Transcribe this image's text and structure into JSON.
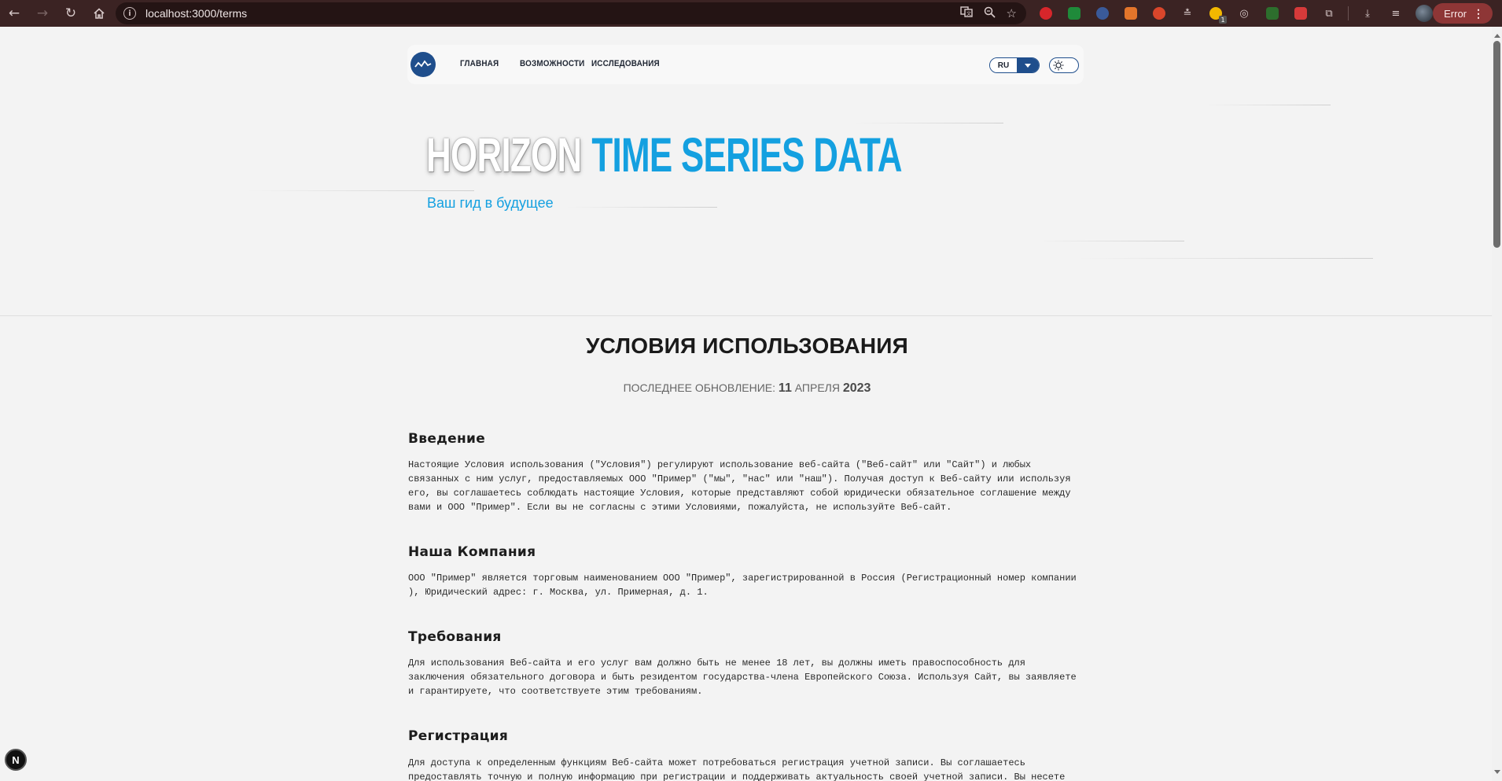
{
  "browser": {
    "url": "localhost:3000/terms",
    "error_label": "Error",
    "extension_badge": "1"
  },
  "navbar": {
    "links": [
      "ГЛАВНАЯ",
      "ВОЗМОЖНОСТИ",
      "ИССЛЕДОВАНИЯ"
    ],
    "language": "RU"
  },
  "hero": {
    "title_part1": "HORIZON",
    "title_part2": "TIME SERIES DATA",
    "subtitle": "Ваш гид в будущее"
  },
  "terms": {
    "title": "УСЛОВИЯ ИСПОЛЬЗОВАНИЯ",
    "updated_prefix": "ПОСЛЕДНЕЕ ОБНОВЛЕНИЕ: ",
    "updated_day": "11",
    "updated_month": " АПРЕЛЯ ",
    "updated_year": "2023",
    "sections": [
      {
        "heading": "Введение",
        "lines": [
          "Настоящие Условия использования (\"Условия\") регулируют использование веб-сайта (\"Веб-сайт\" или \"Сайт\") и любых",
          "связанных с ним услуг, предоставляемых ООО \"Пример\" (\"мы\", \"нас\" или \"наш\"). Получая доступ к Веб-сайту или используя",
          "его, вы соглашаетесь соблюдать настоящие Условия, которые представляют собой юридически обязательное соглашение между",
          "вами и ООО \"Пример\". Если вы не согласны с этими Условиями, пожалуйста, не используйте Веб-сайт."
        ]
      },
      {
        "heading": "Наша Компания",
        "lines": [
          "ООО \"Пример\" является торговым наименованием ООО \"Пример\", зарегистрированной в Россия (Регистрационный номер компании",
          "), Юридический адрес: г. Москва, ул. Примерная, д. 1."
        ]
      },
      {
        "heading": "Требования",
        "lines": [
          "Для использования Веб-сайта и его услуг вам должно быть не менее 18 лет, вы должны иметь правоспособность для",
          "заключения обязательного договора и быть резидентом государства-члена Европейского Союза. Используя Сайт, вы заявляете",
          "и гарантируете, что соответствуете этим требованиям."
        ]
      },
      {
        "heading": "Регистрация",
        "lines": [
          "Для доступа к определенным функциям Веб-сайта может потребоваться регистрация учетной записи. Вы соглашаетесь",
          "предоставлять точную и полную информацию при регистрации и поддерживать актуальность своей учетной записи. Вы несете"
        ]
      }
    ]
  },
  "dev_indicator": "N",
  "colors": {
    "accent_blue": "#14a0e0",
    "navy": "#1f4e8c",
    "chrome_bar": "#3b2323",
    "error_pill": "#8e3636"
  }
}
